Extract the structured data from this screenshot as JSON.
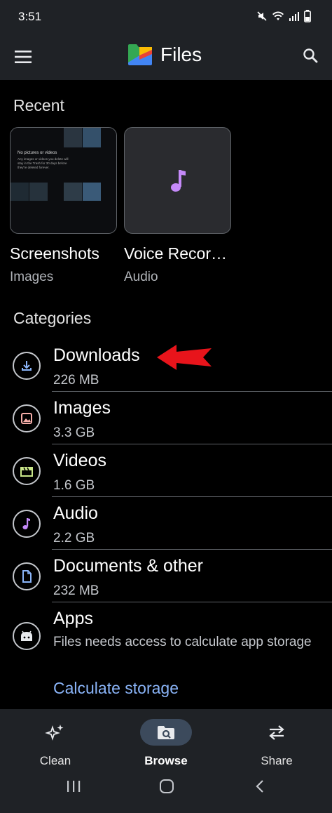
{
  "status_bar": {
    "time": "3:51"
  },
  "app_bar": {
    "title": "Files",
    "menu_icon": "hamburger-menu-icon",
    "search_icon": "search-icon"
  },
  "recent": {
    "title": "Recent",
    "items": [
      {
        "name": "Screenshots",
        "type": "Images",
        "thumb_text": "No pictures or videos",
        "thumb_subtext": "Any images or videos you delete will stay in the Trash for 30 days before they're deleted forever."
      },
      {
        "name": "Voice Recor…",
        "type": "Audio",
        "icon": "music-note-icon"
      }
    ]
  },
  "categories": {
    "title": "Categories",
    "items": [
      {
        "name": "Downloads",
        "size": "226 MB",
        "icon": "download-icon"
      },
      {
        "name": "Images",
        "size": "3.3 GB",
        "icon": "image-icon"
      },
      {
        "name": "Videos",
        "size": "1.6 GB",
        "icon": "video-icon"
      },
      {
        "name": "Audio",
        "size": "2.2 GB",
        "icon": "audio-icon"
      },
      {
        "name": "Documents & other",
        "size": "232 MB",
        "icon": "document-icon"
      },
      {
        "name": "Apps",
        "size": "Files needs access to calculate app storage",
        "icon": "apps-icon",
        "action": "Calculate storage"
      }
    ]
  },
  "bottom_nav": {
    "items": [
      {
        "label": "Clean",
        "icon": "sparkle-icon",
        "active": false
      },
      {
        "label": "Browse",
        "icon": "browse-icon",
        "active": true
      },
      {
        "label": "Share",
        "icon": "share-swap-icon",
        "active": false
      }
    ]
  },
  "colors": {
    "accent": "#8ab4f8",
    "bar_bg": "#1f2226",
    "page_bg": "#000000",
    "active_pill": "#3c4a5c",
    "annotation_arrow": "#e8141b"
  }
}
